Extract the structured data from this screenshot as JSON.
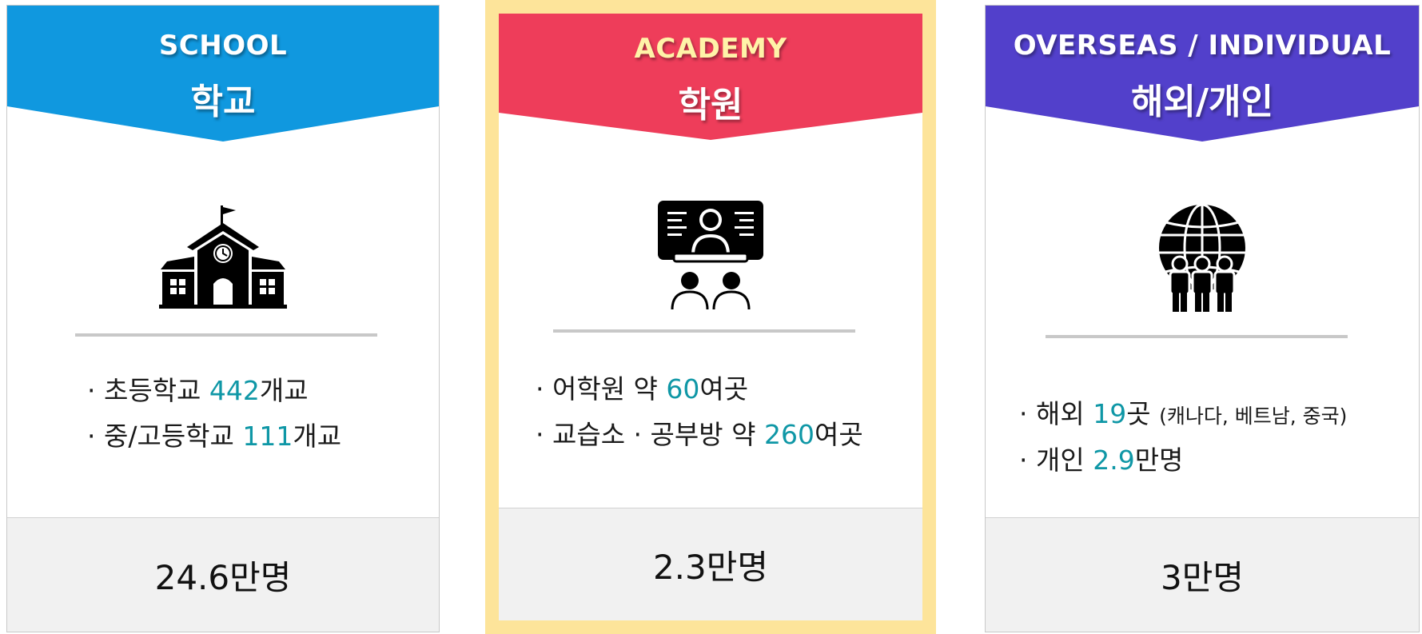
{
  "colors": {
    "school": "#1098df",
    "academy": "#ee3d5a",
    "overseas": "#5240cb",
    "highlight_border": "#fde49a",
    "number_accent": "#0f97a6"
  },
  "cards": [
    {
      "title_en": "SCHOOL",
      "title_ko": "학교",
      "icon": "school-building-icon",
      "lines": [
        {
          "prefix": "· 초등학교  ",
          "num": "442",
          "suffix": "개교",
          "note": ""
        },
        {
          "prefix": "· 중/고등학교  ",
          "num": "111",
          "suffix": "개교",
          "note": ""
        }
      ],
      "total": "24.6만명"
    },
    {
      "title_en": "ACADEMY",
      "title_ko": "학원",
      "icon": "classroom-teacher-icon",
      "lines": [
        {
          "prefix": "· 어학원  약 ",
          "num": "60",
          "suffix": "여곳",
          "note": ""
        },
        {
          "prefix": "· 교습소 · 공부방  약 ",
          "num": "260",
          "suffix": "여곳",
          "note": ""
        }
      ],
      "total": "2.3만명"
    },
    {
      "title_en": "OVERSEAS / INDIVIDUAL",
      "title_ko": "해외/개인",
      "icon": "globe-people-icon",
      "lines": [
        {
          "prefix": "· 해외  ",
          "num": "19",
          "suffix": "곳 ",
          "note": "(캐나다, 베트남, 중국)"
        },
        {
          "prefix": "· 개인  ",
          "num": "2.9",
          "suffix": "만명",
          "note": ""
        }
      ],
      "total": "3만명"
    }
  ]
}
